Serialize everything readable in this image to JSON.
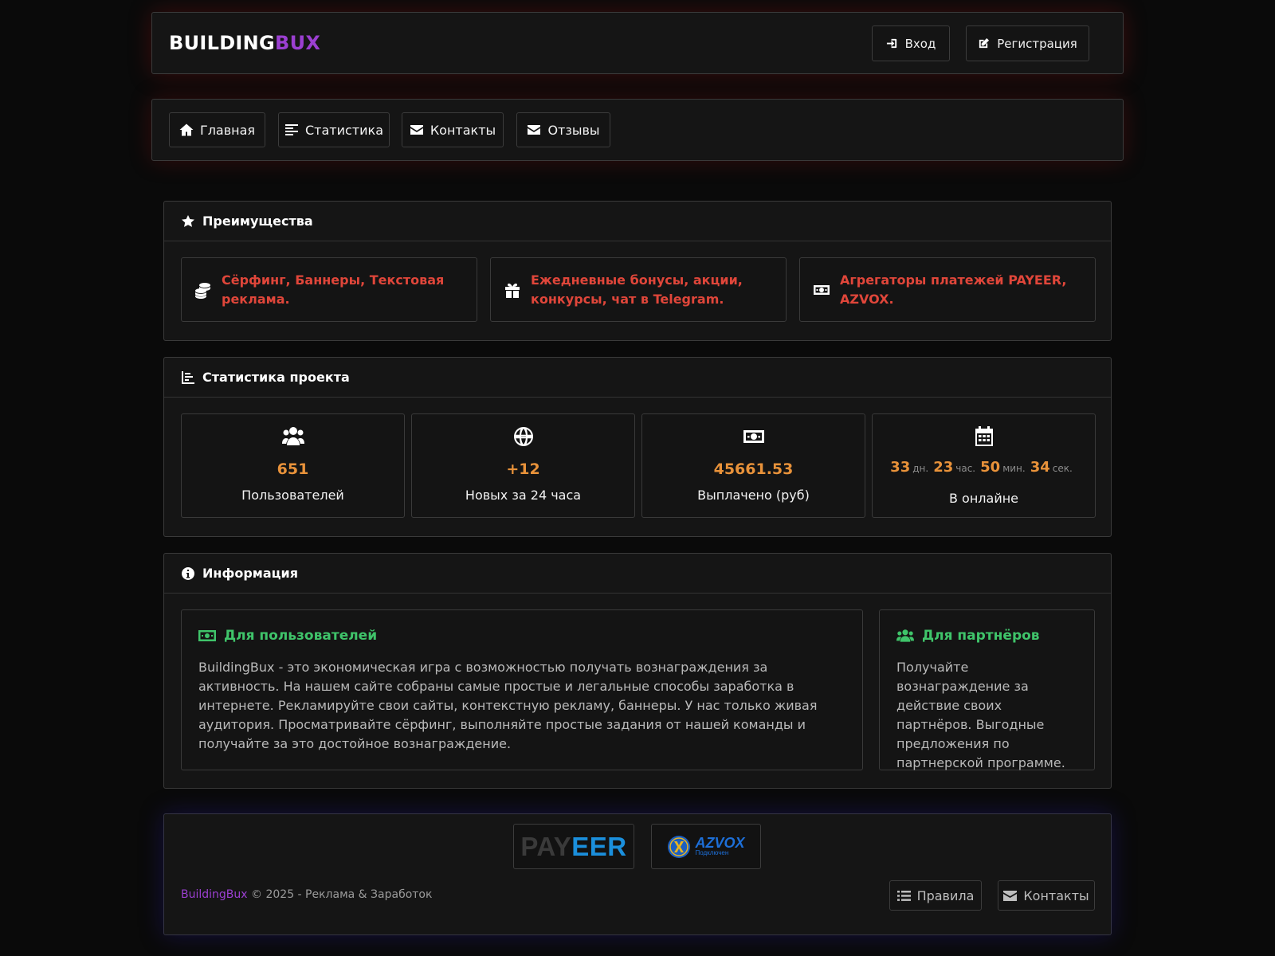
{
  "header": {
    "logo_main": "BUILDING",
    "logo_accent": "BUX",
    "login_label": "Вход",
    "register_label": "Регистрация"
  },
  "nav": {
    "items": [
      {
        "label": "Главная",
        "icon": "home-icon"
      },
      {
        "label": "Статистика",
        "icon": "align-left-icon"
      },
      {
        "label": "Контакты",
        "icon": "envelope-icon"
      },
      {
        "label": "Отзывы",
        "icon": "envelope-icon"
      }
    ]
  },
  "advantages": {
    "title": "Преимущества",
    "items": [
      {
        "text": "Сёрфинг, Баннеры, Текстовая реклама.",
        "icon": "coins-icon"
      },
      {
        "text": "Ежедневные бонусы, акции, конкурсы, чат в Telegram.",
        "icon": "gift-icon"
      },
      {
        "text": "Агрегаторы платежей PAYEER, AZVOX.",
        "icon": "money-bill-icon"
      }
    ]
  },
  "stats": {
    "title": "Статистика проекта",
    "items": [
      {
        "value": "651",
        "label": "Пользователей",
        "icon": "users-icon"
      },
      {
        "value": "+12",
        "label": "Новых за 24 часа",
        "icon": "globe-icon"
      },
      {
        "value": "45661.53",
        "label": "Выплачено (руб)",
        "icon": "money-bill-icon"
      }
    ],
    "online": {
      "days": "33",
      "days_unit": "дн.",
      "hours": "23",
      "hours_unit": "час.",
      "minutes": "50",
      "minutes_unit": "мин.",
      "seconds": "34",
      "seconds_unit": "сек.",
      "label": "В онлайне",
      "icon": "calendar-icon"
    }
  },
  "info": {
    "title": "Информация",
    "users": {
      "title": "Для пользователей",
      "text": "BuildingBux - это экономическая игра с возможностью получать вознаграждения за активность. На нашем сайте собраны самые простые и легальные способы заработка в интернете. Рекламируйте свои сайты, контекстную рекламу, баннеры. У нас только живая аудитория. Просматривайте сёрфинг, выполняйте простые задания от нашей команды и получайте за это достойное вознаграждение."
    },
    "partners": {
      "title": "Для партнёров",
      "text": "Получайте вознаграждение за действие своих партнёров. Выгодные предложения по партнерской программе."
    }
  },
  "footer": {
    "payeer_pay": "PAY",
    "payeer_eer": "EER",
    "azvox_name": "AZVOX",
    "azvox_sub": "Подключен",
    "brand": "BuildingBux",
    "copyright": "© 2025 - Реклама & Заработок",
    "rules_label": "Правила",
    "contacts_label": "Контакты"
  },
  "colors": {
    "accent_purple": "#9b3fd1",
    "advantage_red": "#e0463a",
    "stat_orange": "#e8923a",
    "info_green": "#3fc46a",
    "payeer_blue": "#1b8fdc"
  }
}
